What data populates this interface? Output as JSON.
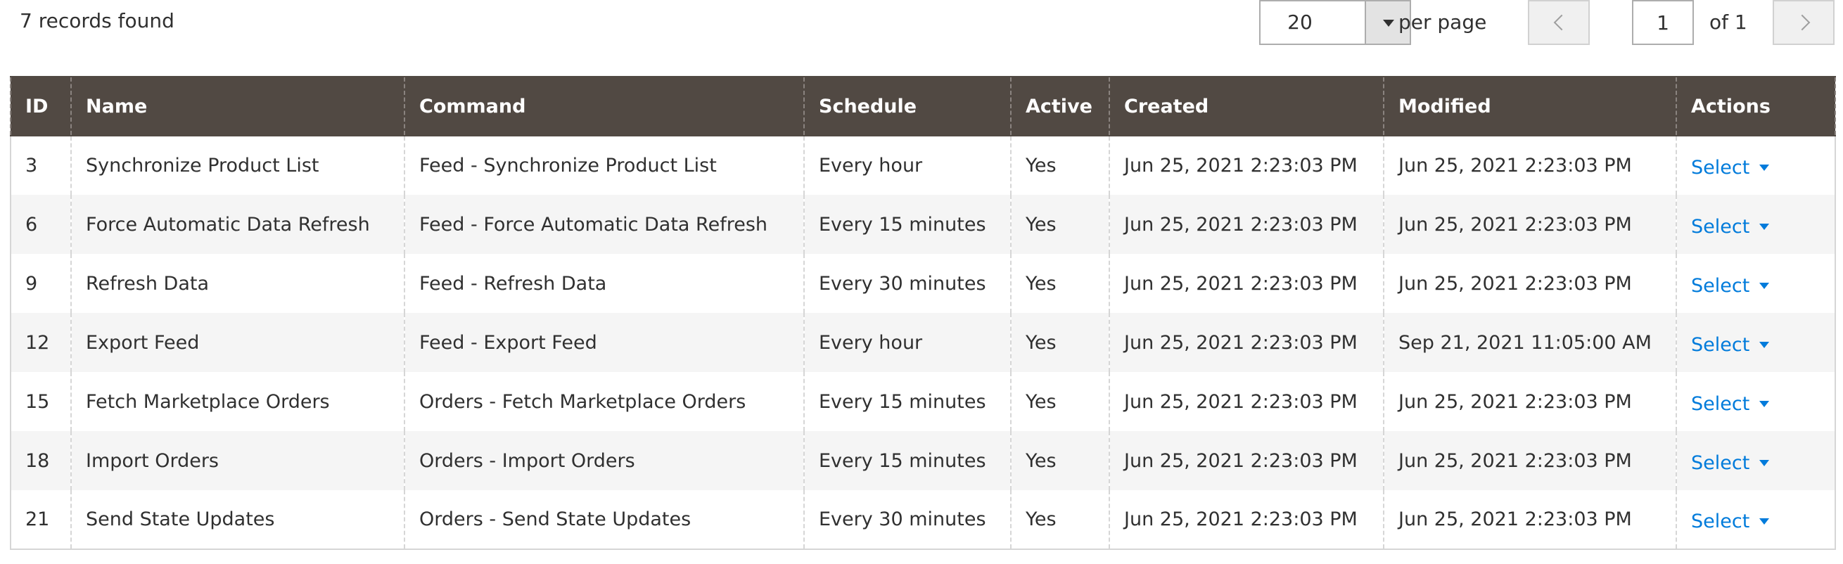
{
  "toolbar": {
    "records_found": "7 records found",
    "per_page_value": "20",
    "per_page_label": "per page",
    "current_page": "1",
    "page_total": "of 1"
  },
  "columns": [
    "ID",
    "Name",
    "Command",
    "Schedule",
    "Active",
    "Created",
    "Modified",
    "Actions"
  ],
  "rows": [
    {
      "id": "3",
      "name": "Synchronize Product List",
      "command": "Feed - Synchronize Product List",
      "schedule": "Every hour",
      "active": "Yes",
      "created": "Jun 25, 2021 2:23:03 PM",
      "modified": "Jun 25, 2021 2:23:03 PM",
      "action": "Select"
    },
    {
      "id": "6",
      "name": "Force Automatic Data Refresh",
      "command": "Feed - Force Automatic Data Refresh",
      "schedule": "Every 15 minutes",
      "active": "Yes",
      "created": "Jun 25, 2021 2:23:03 PM",
      "modified": "Jun 25, 2021 2:23:03 PM",
      "action": "Select"
    },
    {
      "id": "9",
      "name": "Refresh Data",
      "command": "Feed - Refresh Data",
      "schedule": "Every 30 minutes",
      "active": "Yes",
      "created": "Jun 25, 2021 2:23:03 PM",
      "modified": "Jun 25, 2021 2:23:03 PM",
      "action": "Select"
    },
    {
      "id": "12",
      "name": "Export Feed",
      "command": "Feed - Export Feed",
      "schedule": "Every hour",
      "active": "Yes",
      "created": "Jun 25, 2021 2:23:03 PM",
      "modified": "Sep 21, 2021 11:05:00 AM",
      "action": "Select"
    },
    {
      "id": "15",
      "name": "Fetch Marketplace Orders",
      "command": "Orders - Fetch Marketplace Orders",
      "schedule": "Every 15 minutes",
      "active": "Yes",
      "created": "Jun 25, 2021 2:23:03 PM",
      "modified": "Jun 25, 2021 2:23:03 PM",
      "action": "Select"
    },
    {
      "id": "18",
      "name": "Import Orders",
      "command": "Orders - Import Orders",
      "schedule": "Every 15 minutes",
      "active": "Yes",
      "created": "Jun 25, 2021 2:23:03 PM",
      "modified": "Jun 25, 2021 2:23:03 PM",
      "action": "Select"
    },
    {
      "id": "21",
      "name": "Send State Updates",
      "command": "Orders - Send State Updates",
      "schedule": "Every 30 minutes",
      "active": "Yes",
      "created": "Jun 25, 2021 2:23:03 PM",
      "modified": "Jun 25, 2021 2:23:03 PM",
      "action": "Select"
    }
  ],
  "icons": {
    "per_page_dropdown": "caret-down-icon",
    "prev_page": "chevron-left-icon",
    "next_page": "chevron-right-icon",
    "action_dropdown": "caret-down-icon"
  },
  "colors": {
    "header_bg": "#514943",
    "link": "#007bdb",
    "row_alt": "#f5f5f5"
  }
}
